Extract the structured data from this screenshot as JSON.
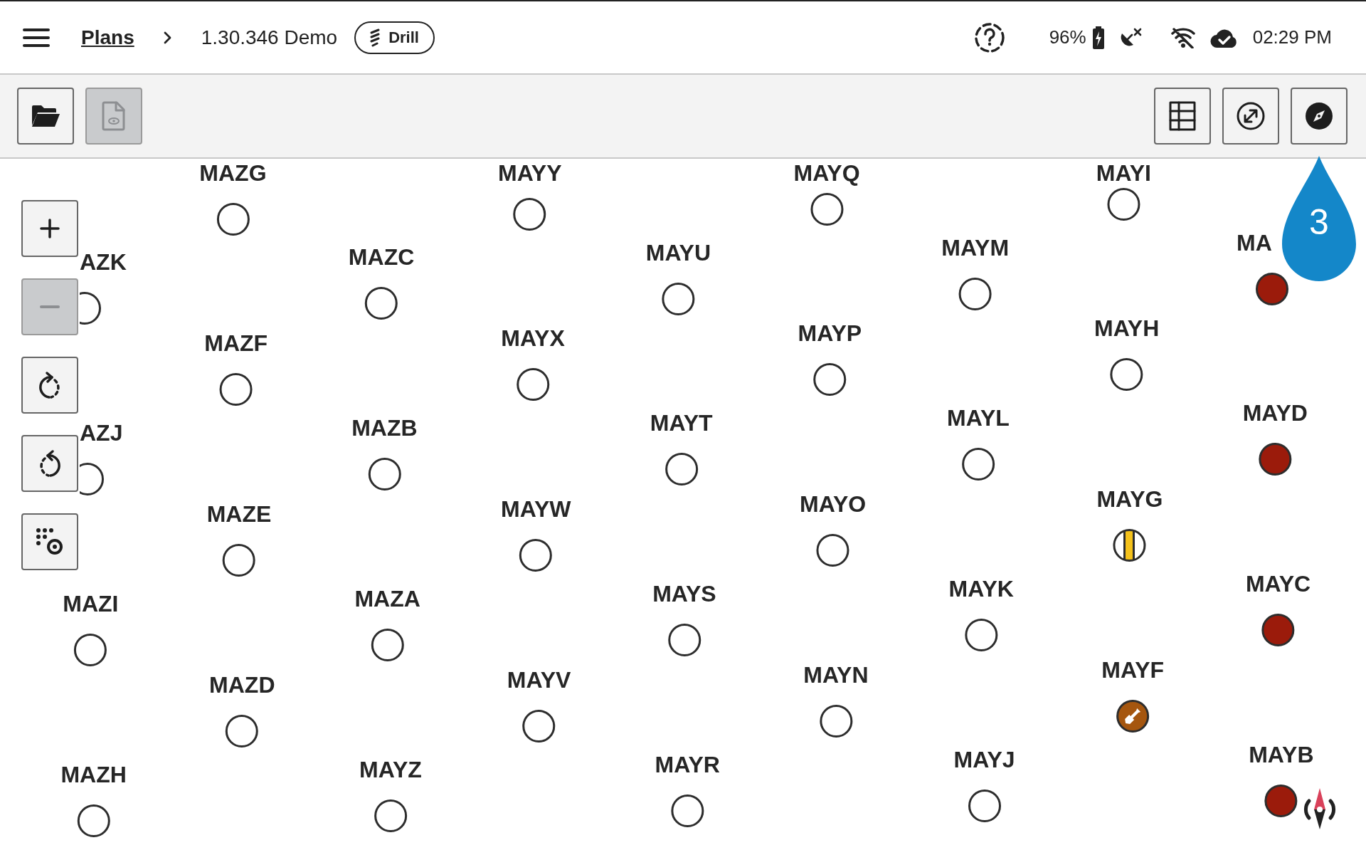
{
  "header": {
    "breadcrumb": {
      "link": "Plans",
      "current": "1.30.346 Demo"
    },
    "mode_chip": "Drill",
    "status": {
      "battery": "96%",
      "time": "02:29 PM"
    }
  },
  "toolbar": {
    "left_buttons": [
      {
        "kind": "folder",
        "disabled": false
      },
      {
        "kind": "document",
        "disabled": true
      }
    ],
    "right_buttons": [
      {
        "kind": "grid",
        "disabled": false
      },
      {
        "kind": "resize",
        "disabled": false
      },
      {
        "kind": "compass",
        "disabled": false
      }
    ],
    "step_badge": "3"
  },
  "map_controls": [
    {
      "kind": "zoom_in",
      "disabled": false
    },
    {
      "kind": "zoom_out",
      "disabled": true
    },
    {
      "kind": "rotate_cw",
      "disabled": false
    },
    {
      "kind": "rotate_ccw",
      "disabled": false
    },
    {
      "kind": "points",
      "disabled": false
    }
  ],
  "columns": [
    {
      "holes": [
        {
          "label": "AZK",
          "kind": "open"
        },
        {
          "label": "AZJ",
          "kind": "open"
        },
        {
          "label": "MAZI",
          "kind": "open"
        },
        {
          "label": "MAZH",
          "kind": "open"
        }
      ]
    },
    {
      "holes": [
        {
          "label": "MAZG",
          "kind": "open"
        },
        {
          "label": "MAZF",
          "kind": "open"
        },
        {
          "label": "MAZE",
          "kind": "open"
        },
        {
          "label": "MAZD",
          "kind": "open"
        }
      ]
    },
    {
      "holes": [
        {
          "label": "MAZC",
          "kind": "open"
        },
        {
          "label": "MAZB",
          "kind": "open"
        },
        {
          "label": "MAZA",
          "kind": "open"
        },
        {
          "label": "MAYZ",
          "kind": "open"
        }
      ]
    },
    {
      "holes": [
        {
          "label": "MAYY",
          "kind": "open"
        },
        {
          "label": "MAYX",
          "kind": "open"
        },
        {
          "label": "MAYW",
          "kind": "open"
        },
        {
          "label": "MAYV",
          "kind": "open"
        }
      ]
    },
    {
      "holes": [
        {
          "label": "MAYU",
          "kind": "open"
        },
        {
          "label": "MAYT",
          "kind": "open"
        },
        {
          "label": "MAYS",
          "kind": "open"
        },
        {
          "label": "MAYR",
          "kind": "open"
        }
      ]
    },
    {
      "holes": [
        {
          "label": "MAYQ",
          "kind": "open"
        },
        {
          "label": "MAYP",
          "kind": "open"
        },
        {
          "label": "MAYO",
          "kind": "open"
        },
        {
          "label": "MAYN",
          "kind": "open"
        }
      ]
    },
    {
      "holes": [
        {
          "label": "MAYM",
          "kind": "open"
        },
        {
          "label": "MAYL",
          "kind": "open"
        },
        {
          "label": "MAYK",
          "kind": "open"
        },
        {
          "label": "MAYJ",
          "kind": "open"
        }
      ]
    },
    {
      "holes": [
        {
          "label": "MAYI",
          "kind": "open"
        },
        {
          "label": "MAYH",
          "kind": "open"
        },
        {
          "label": "MAYG",
          "kind": "partial"
        },
        {
          "label": "MAYF",
          "kind": "dug"
        }
      ]
    },
    {
      "holes": [
        {
          "label": "MA",
          "kind": "drilled"
        },
        {
          "label": "MAYD",
          "kind": "drilled"
        },
        {
          "label": "MAYC",
          "kind": "drilled"
        },
        {
          "label": "MAYB",
          "kind": "drilled"
        }
      ]
    }
  ]
}
